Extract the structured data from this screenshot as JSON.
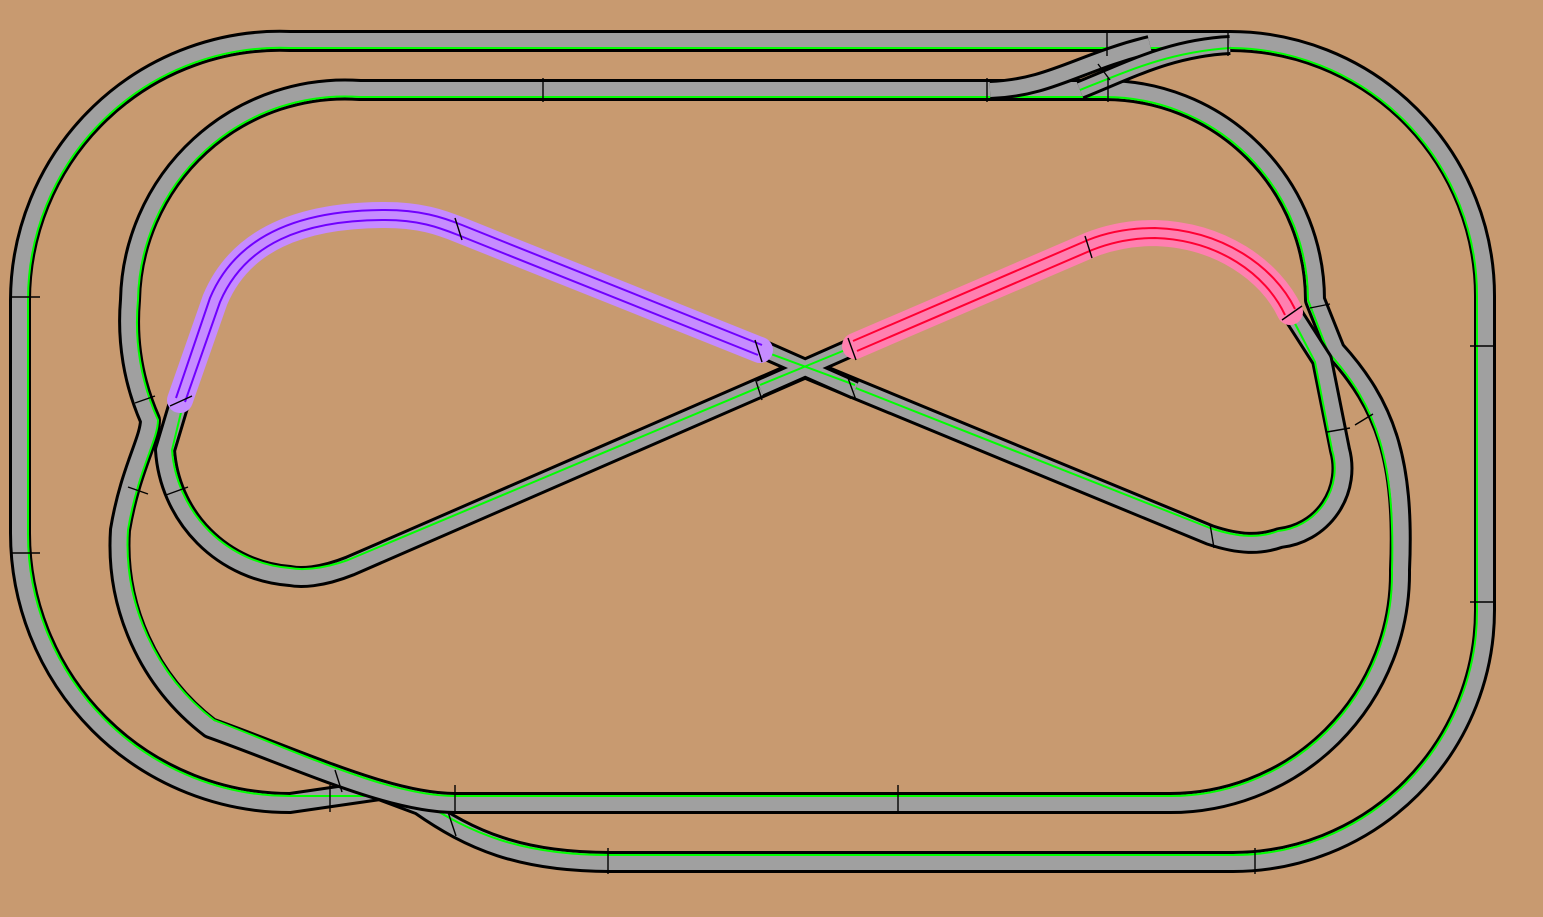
{
  "colors": {
    "background": "#c89a70",
    "rail_edge": "#000000",
    "track_bed": "#a0a0a0",
    "powered_line": "#00ff00",
    "joint": "#000000",
    "selected_block_purple": "#7000ff",
    "selected_block_purple_glow": "#c68cff",
    "selected_block_red": "#ff0033",
    "selected_block_red_glow": "#ff80b0"
  },
  "tracks": {
    "outer_loop": {
      "powered": true
    },
    "inner_loop": {
      "powered": true
    },
    "figure_eight": {
      "powered": true
    },
    "purple_block": {
      "selected": true,
      "color_key": "selected_block_purple"
    },
    "red_block": {
      "selected": true,
      "color_key": "selected_block_red"
    }
  }
}
